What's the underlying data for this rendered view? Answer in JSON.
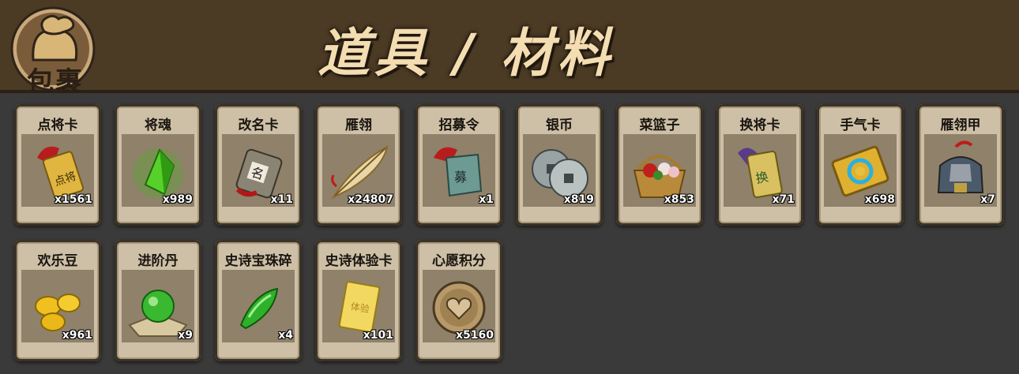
{
  "header": {
    "bag_label": "包裹",
    "title": "道具 / 材料"
  },
  "items": [
    {
      "name": "点将卡",
      "count": "x1561",
      "icon": "dianjiang-card-icon"
    },
    {
      "name": "将魂",
      "count": "x989",
      "icon": "jianghun-crystal-icon"
    },
    {
      "name": "改名卡",
      "count": "x11",
      "icon": "rename-card-icon"
    },
    {
      "name": "雁翎",
      "count": "x24807",
      "icon": "feather-icon"
    },
    {
      "name": "招募令",
      "count": "x1",
      "icon": "recruit-token-icon"
    },
    {
      "name": "银币",
      "count": "x819",
      "icon": "silver-coin-icon"
    },
    {
      "name": "菜篮子",
      "count": "x853",
      "icon": "basket-icon"
    },
    {
      "name": "换将卡",
      "count": "x71",
      "icon": "swap-card-icon"
    },
    {
      "name": "手气卡",
      "count": "x698",
      "icon": "luck-card-icon"
    },
    {
      "name": "雁翎甲",
      "count": "x7",
      "icon": "armor-icon"
    },
    {
      "name": "欢乐豆",
      "count": "x961",
      "icon": "beans-icon"
    },
    {
      "name": "进阶丹",
      "count": "x9",
      "icon": "pill-orb-icon"
    },
    {
      "name": "史诗宝珠碎",
      "count": "x4",
      "icon": "jade-shard-icon"
    },
    {
      "name": "史诗体验卡",
      "count": "x101",
      "icon": "gold-card-icon"
    },
    {
      "name": "心愿积分",
      "count": "x5160",
      "icon": "heart-coin-icon"
    }
  ]
}
